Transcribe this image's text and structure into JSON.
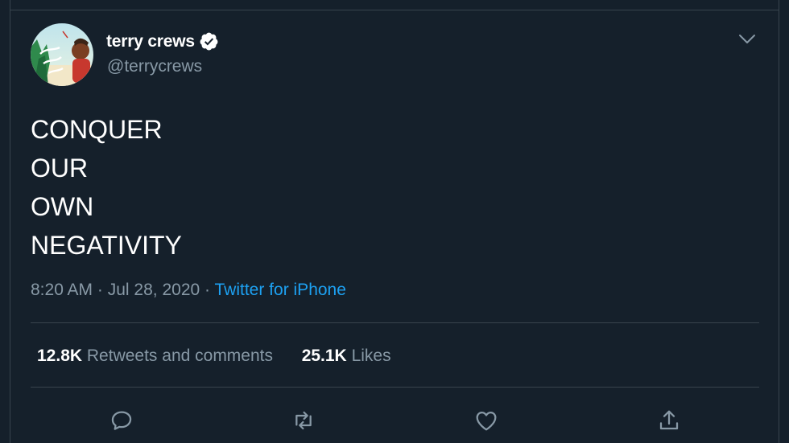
{
  "tweet": {
    "author": {
      "display_name": "terry crews",
      "handle": "@terrycrews",
      "verified": true,
      "avatar_icon": "avatar-come-find-me-illustration"
    },
    "text_lines": [
      "CONQUER",
      "OUR",
      "OWN",
      "NEGATIVITY"
    ],
    "time": "8:20 AM",
    "separator": "·",
    "date": "Jul 28, 2020",
    "source": "Twitter for iPhone",
    "stats": {
      "retweets_count": "12.8K",
      "retweets_label": "Retweets and comments",
      "likes_count": "25.1K",
      "likes_label": "Likes"
    },
    "actions": [
      "reply-icon",
      "retweet-icon",
      "like-icon",
      "share-icon"
    ]
  },
  "colors": {
    "background": "#15202b",
    "border": "#38444d",
    "secondary_text": "#8899a6",
    "accent": "#1da1f2",
    "primary_text": "#ffffff"
  }
}
